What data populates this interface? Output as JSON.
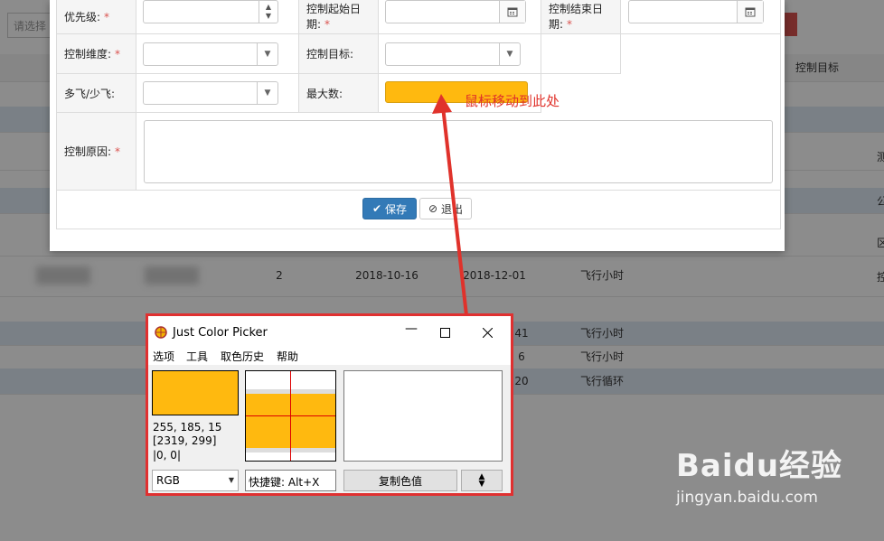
{
  "background_table": {
    "search_placeholder": "请选择",
    "header_last": "控制目标",
    "rows": [
      {
        "value": "2",
        "start": "2018-10-16",
        "end": "2018-12-01",
        "type": "飞行小时"
      },
      {
        "time": "41",
        "type": "飞行小时"
      },
      {
        "time": "6",
        "type": "飞行小时"
      },
      {
        "time": "20",
        "type": "飞行循环"
      }
    ],
    "side_chars": [
      "测",
      "公",
      "区",
      "控"
    ]
  },
  "form": {
    "labels": {
      "priority": "优先级:",
      "start_date": "控制起始日期:",
      "end_date": "控制结束日期:",
      "dimension": "控制维度:",
      "target": "控制目标:",
      "more_less": "多飞/少飞:",
      "max": "最大数:",
      "reason": "控制原因:"
    },
    "required_mark": "*",
    "max_color": "#FFB90F",
    "buttons": {
      "save": "保存",
      "exit": "退出"
    }
  },
  "annotation": {
    "text": "鼠标移动到此处",
    "color": "#e0322b"
  },
  "picker": {
    "title": "Just Color Picker",
    "menu": [
      "选项",
      "工具",
      "取色历史",
      "帮助"
    ],
    "color_hex": "#FFB90F",
    "rgb_text": "255, 185, 15",
    "coords_text": "[2319, 299]",
    "offset_text": "|0, 0|",
    "mode": "RGB",
    "hotkey": "快捷键: Alt+X",
    "copy_label": "复制色值"
  },
  "watermark": {
    "brand": "Baidu经验",
    "url": "jingyan.baidu.com"
  }
}
